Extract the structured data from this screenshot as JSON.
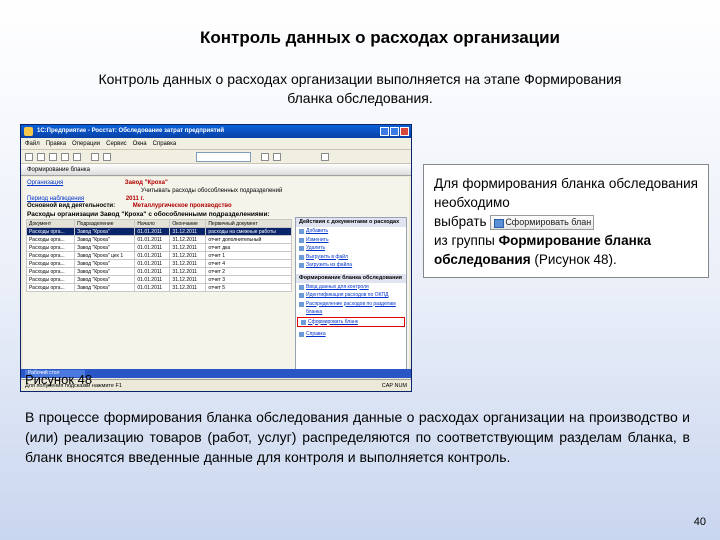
{
  "slide": {
    "title": "Контроль данных о расходах организации",
    "subtitle": "Контроль данных о расходах организации выполняется на этапе Формирования бланка обследования.",
    "caption": "Рисунок 48",
    "body": "В процессе формирования бланка обследования данные о расходах организации на производство и (или) реализацию товаров (работ, услуг) распределяются по соответствующим разделам бланка, в бланк вносятся введенные данные для контроля и выполняется контроль.",
    "page_number": "40"
  },
  "callout": {
    "line1": "Для формирования бланка обследования необходимо",
    "line2_prefix": "выбрать",
    "button_label": "Сформировать блан",
    "line3_prefix": "из группы ",
    "group_name": "Формирование бланка обследования",
    "line3_suffix": " (Рисунок 48)."
  },
  "screenshot": {
    "window_title": "1С:Предприятие - Росстат: Обследование затрат предприятий",
    "menu": [
      "Файл",
      "Правка",
      "Операции",
      "Сервис",
      "Окна",
      "Справка"
    ],
    "form_title": "Формирование бланка",
    "org_link": "Организация",
    "org_value": "Завод \"Кроха\"",
    "flag_text": "Учитывать расходы обособленных подразделений",
    "period_link": "Период наблюдения",
    "period_value": "2011 г.",
    "activity_label": "Основной вид деятельности:",
    "activity_value": "Металлургическое производство",
    "section_title": "Расходы организации Завод \"Кроха\" с обособленными подразделениями:",
    "table": {
      "headers": [
        "Документ",
        "Подразделение",
        "Начало",
        "Окончание",
        "Первичный документ"
      ],
      "rows": [
        [
          "Расходы орга...",
          "Завод \"Кроха\"",
          "01.01.2011",
          "31.12.2011",
          "расходы на смежные работы"
        ],
        [
          "Расходы орга...",
          "Завод \"Кроха\"",
          "01.01.2011",
          "31.12.2011",
          "отчет дополнительный"
        ],
        [
          "Расходы орга...",
          "Завод \"Кроха\"",
          "01.01.2011",
          "31.12.2011",
          "отчет дка"
        ],
        [
          "Расходы орга...",
          "Завод \"Кроха\" цех 1",
          "01.01.2011",
          "31.12.2011",
          "отчет 1"
        ],
        [
          "Расходы орга...",
          "Завод \"Кроха\"",
          "01.01.2011",
          "31.12.2011",
          "отчет 4"
        ],
        [
          "Расходы орга...",
          "Завод \"Кроха\"",
          "01.01.2011",
          "31.12.2011",
          "отчет 2"
        ],
        [
          "Расходы орга...",
          "Завод \"Кроха\"",
          "01.01.2011",
          "31.12.2011",
          "отчет 3"
        ],
        [
          "Расходы орга...",
          "Завод \"Кроха\"",
          "01.01.2011",
          "31.12.2011",
          "отчет 5"
        ]
      ]
    },
    "panel": {
      "header1": "Действия с документами о расходах",
      "actions1": [
        "Добавить",
        "Изменить",
        "Удалить",
        "Выгрузить в файл",
        "Загрузить из файла"
      ],
      "header2": "Формирование бланка обследования",
      "actions2": [
        "Ввод данных для контроля",
        "Идентификация расходов по ОКПД",
        "Распределение расходов по разделам бланка"
      ],
      "highlighted": "Сформировать бланк",
      "help": "Справка"
    },
    "taskbar_tab": "Рабочий стол программы",
    "status_text": "Для получения подсказки нажмите F1",
    "status_indicators": "CAP  NUM"
  }
}
